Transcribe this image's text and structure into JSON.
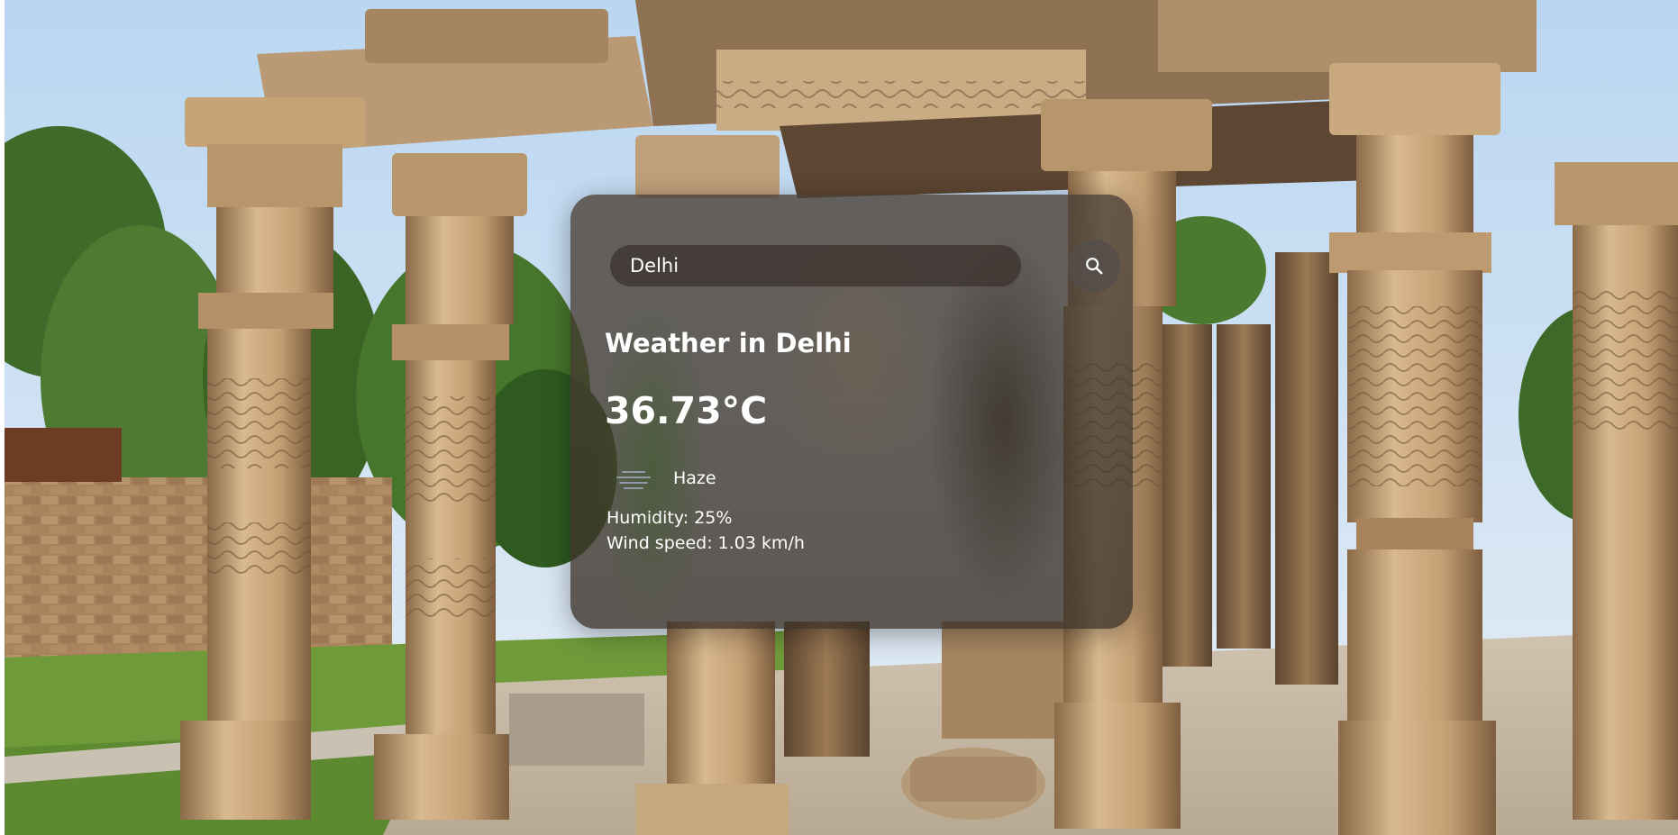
{
  "search": {
    "value": "Delhi",
    "button_icon": "search-icon"
  },
  "weather": {
    "title": "Weather in Delhi",
    "temperature": "36.73°C",
    "condition_icon": "haze-icon",
    "condition": "Haze",
    "humidity": "Humidity: 25%",
    "wind_speed": "Wind speed: 1.03 km/h"
  },
  "colors": {
    "sky": "#cfe3f5",
    "stone": "#b8926a",
    "foliage": "#4f7a32",
    "card_tint": "#3a322a"
  }
}
